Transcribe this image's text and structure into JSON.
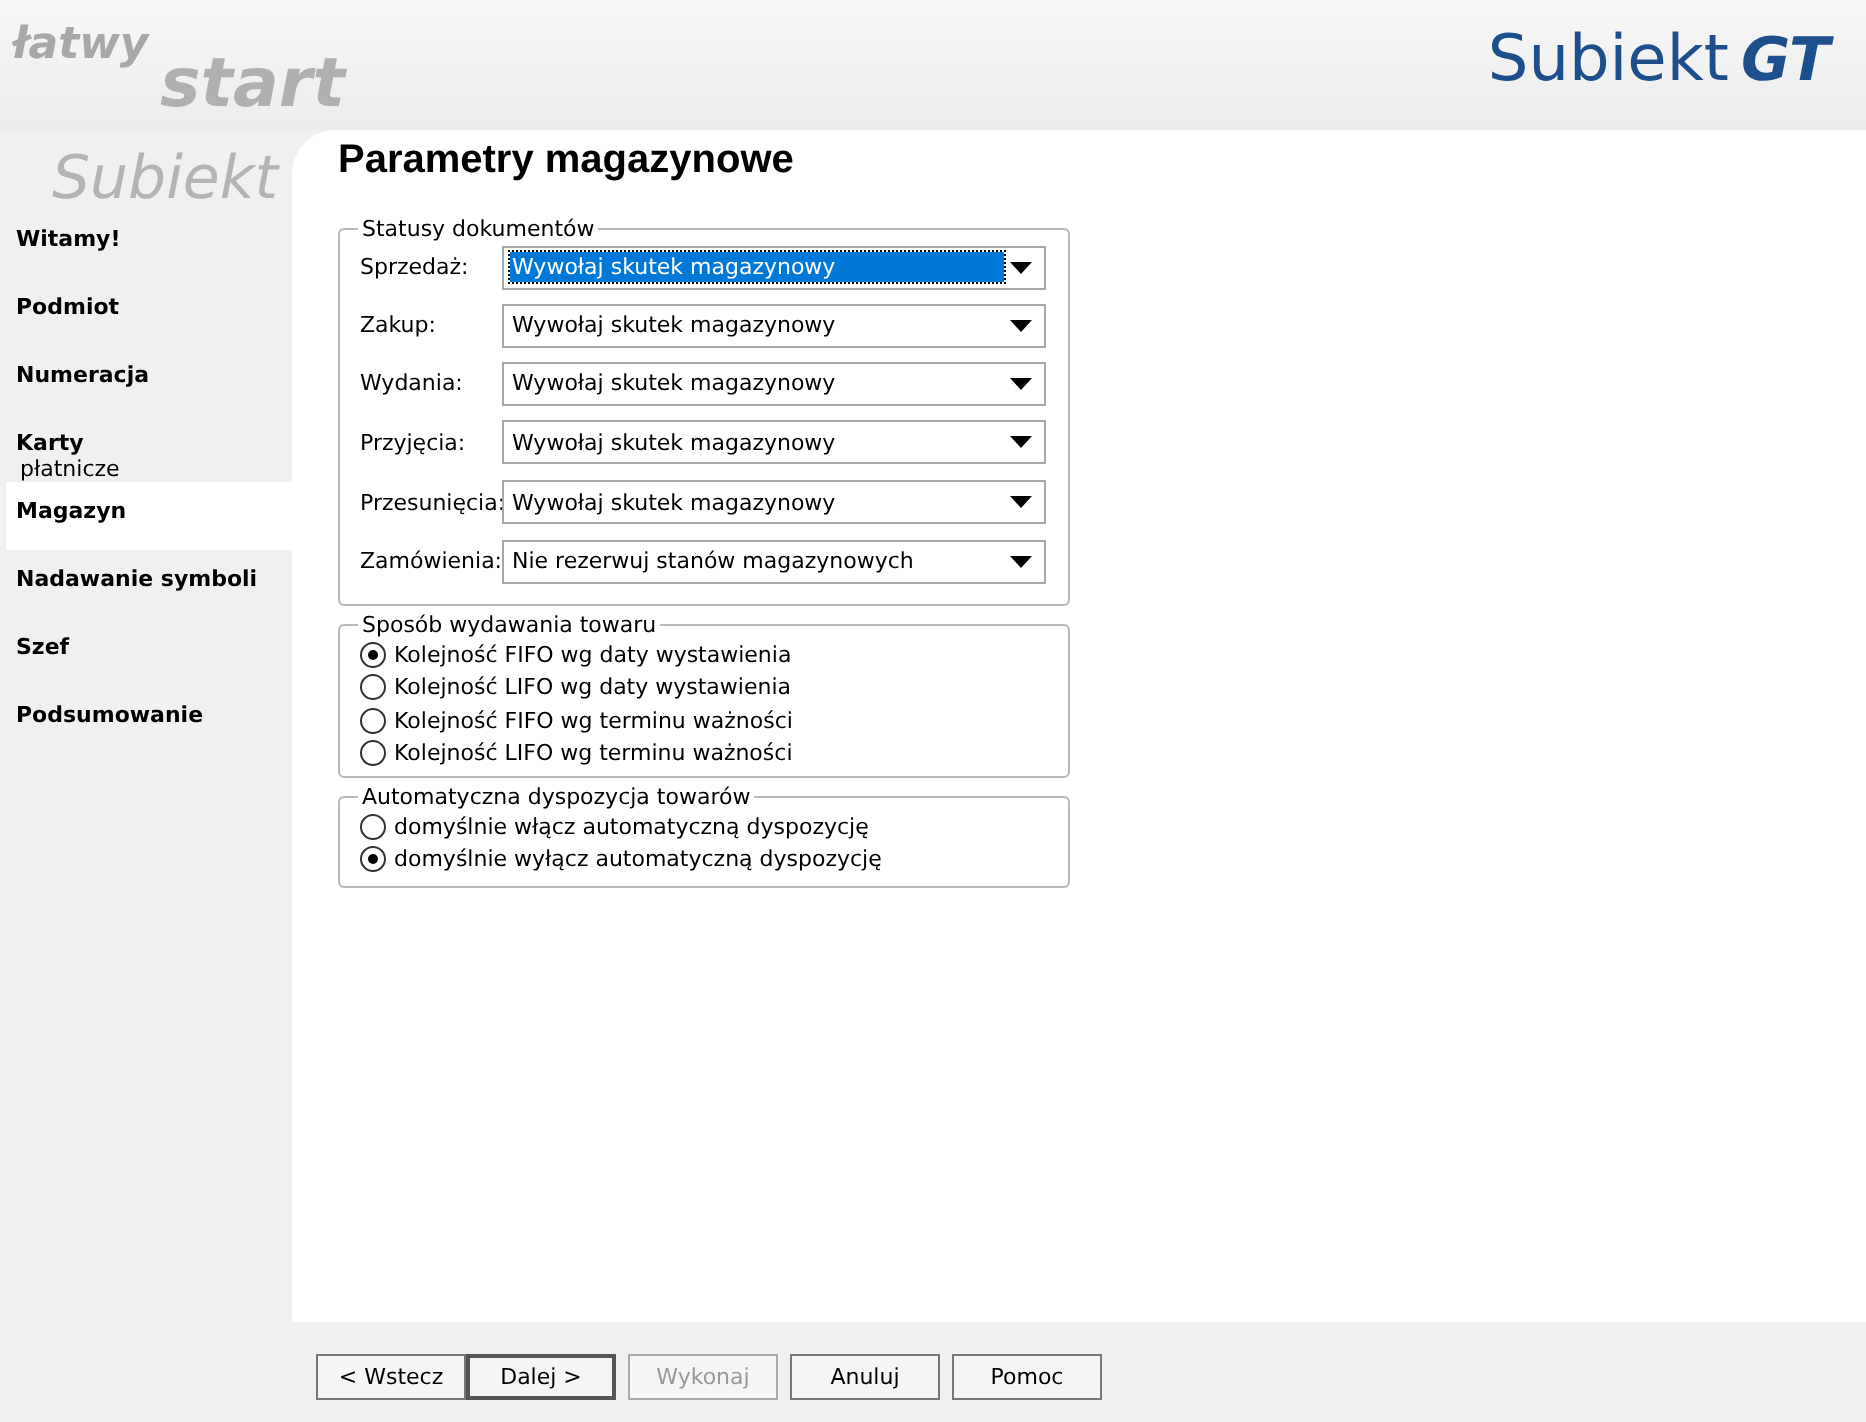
{
  "banner": {
    "art_texts": [
      "łatwy",
      "start",
      "Subiekt"
    ],
    "logo": {
      "name": "Subiekt",
      "suffix": "GT"
    }
  },
  "sidebar": {
    "items": [
      {
        "label": "Witamy!",
        "selected": false
      },
      {
        "label": "Podmiot",
        "selected": false
      },
      {
        "label": "Numeracja",
        "selected": false
      },
      {
        "label": "Karty",
        "sublabel": "płatnicze",
        "selected": false
      },
      {
        "label": "Magazyn",
        "selected": true
      },
      {
        "label": "Nadawanie symboli",
        "selected": false
      },
      {
        "label": "Szef",
        "selected": false
      },
      {
        "label": "Podsumowanie",
        "selected": false
      }
    ]
  },
  "page_title": "Parametry magazynowe",
  "document_statuses": {
    "title": "Statusy dokumentów",
    "fields": [
      {
        "label": "Sprzedaż:",
        "value": "Wywołaj skutek magazynowy",
        "focused": true
      },
      {
        "label": "Zakup:",
        "value": "Wywołaj skutek magazynowy",
        "focused": false
      },
      {
        "label": "Wydania:",
        "value": "Wywołaj skutek magazynowy",
        "focused": false
      },
      {
        "label": "Przyjęcia:",
        "value": "Wywołaj skutek magazynowy",
        "focused": false
      },
      {
        "label": "Przesunięcia:",
        "value": "Wywołaj skutek magazynowy",
        "focused": false
      },
      {
        "label": "Zamówienia:",
        "value": "Nie rezerwuj stanów magazynowych",
        "focused": false
      }
    ]
  },
  "issue_method": {
    "title": "Sposób wydawania towaru",
    "options": [
      {
        "label": "Kolejność FIFO wg daty wystawienia",
        "selected": true
      },
      {
        "label": "Kolejność LIFO wg daty wystawienia",
        "selected": false
      },
      {
        "label": "Kolejność FIFO wg terminu ważności",
        "selected": false
      },
      {
        "label": "Kolejność LIFO wg terminu ważności",
        "selected": false
      }
    ]
  },
  "auto_disposition": {
    "title": "Automatyczna dyspozycja towarów",
    "options": [
      {
        "label": "domyślnie włącz automatyczną dyspozycję",
        "selected": false
      },
      {
        "label": "domyślnie wyłącz automatyczną dyspozycję",
        "selected": true
      }
    ]
  },
  "buttons": [
    {
      "label": "< Wstecz",
      "disabled": false,
      "default": false
    },
    {
      "label": "Dalej >",
      "disabled": false,
      "default": true
    },
    {
      "label": "Wykonaj",
      "disabled": true,
      "default": false
    },
    {
      "label": "Anuluj",
      "disabled": false,
      "default": false
    },
    {
      "label": "Pomoc",
      "disabled": false,
      "default": false
    }
  ]
}
